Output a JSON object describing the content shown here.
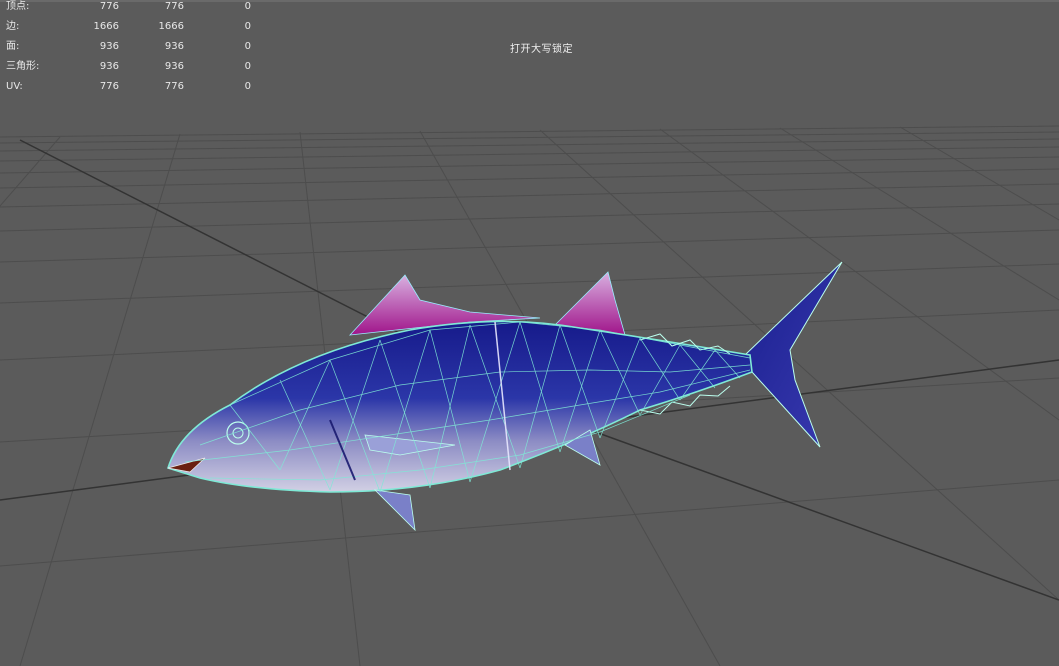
{
  "hud": {
    "rows": [
      {
        "label": "顶点:",
        "v1": "776",
        "v2": "776",
        "v3": "0"
      },
      {
        "label": "边:",
        "v1": "1666",
        "v2": "1666",
        "v3": "0"
      },
      {
        "label": "面:",
        "v1": "936",
        "v2": "936",
        "v3": "0"
      },
      {
        "label": "三角形:",
        "v1": "936",
        "v2": "936",
        "v3": "0"
      },
      {
        "label": "UV:",
        "v1": "776",
        "v2": "776",
        "v3": "0"
      }
    ]
  },
  "caps_lock_text": "打开大写锁定",
  "colors": {
    "background": "#5b5b5b",
    "grid": "#4a4a4a",
    "axis": "#3a3a3a",
    "wire": "#7fe9d6",
    "fish_body": "#2a2f9a",
    "fish_belly": "#b8b6d8",
    "fin_magenta": "#b0208e"
  },
  "viewport": {
    "object": "tuna-fish-mesh"
  }
}
